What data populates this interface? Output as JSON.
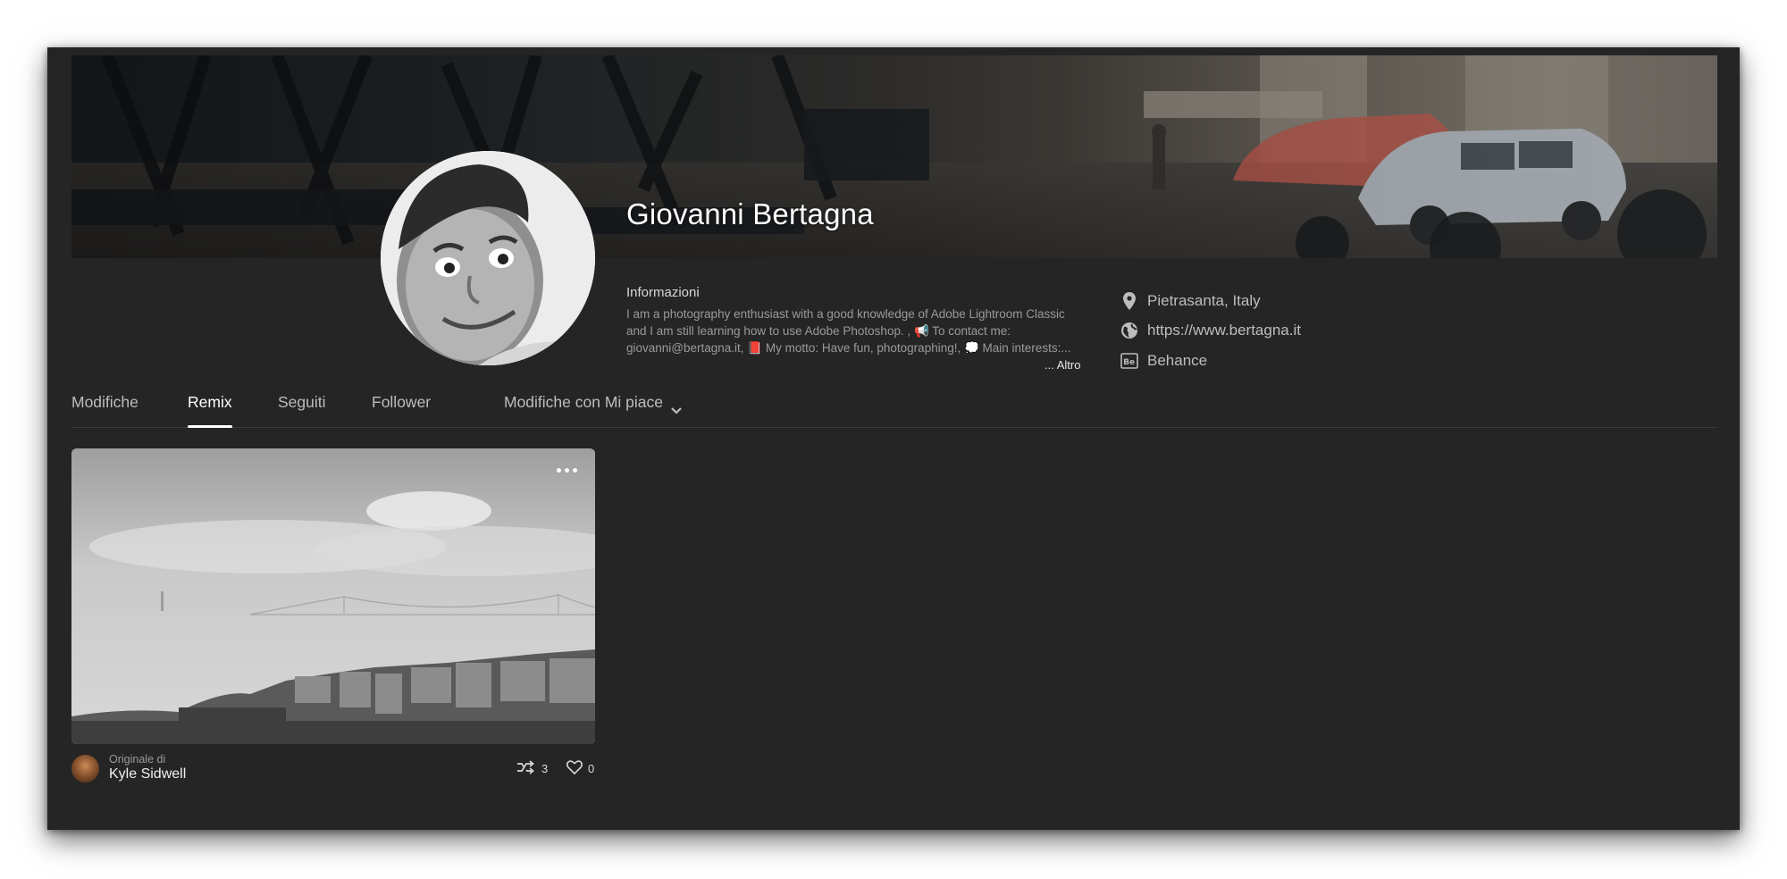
{
  "profile": {
    "name": "Giovanni Bertagna",
    "about_title": "Informazioni",
    "about_text": "I am a photography enthusiast with a good knowledge of Adobe Lightroom Classic and I am still learning how to use Adobe Photoshop. , 📢 To contact me: giovanni@bertagna.it, 📕 My motto: Have fun, photographing!, 💭 Main interests:...",
    "more_label": "... Altro",
    "location": "Pietrasanta, Italy",
    "website": "https://www.bertagna.it",
    "behance": "Behance"
  },
  "icons": {
    "location": "location-pin-icon",
    "website": "globe-icon",
    "behance": "behance-icon",
    "remix": "remix-icon",
    "like": "heart-icon",
    "more": "more-options-icon",
    "dropdown": "chevron-down-icon"
  },
  "tabs": [
    {
      "label": "Modifiche",
      "active": false
    },
    {
      "label": "Remix",
      "active": true
    },
    {
      "label": "Seguiti",
      "active": false
    },
    {
      "label": "Follower",
      "active": false
    },
    {
      "label": "Modifiche con Mi piace",
      "active": false
    }
  ],
  "card": {
    "original_label": "Originale di",
    "author": "Kyle Sidwell",
    "remix_count": "3",
    "like_count": "0"
  },
  "colors": {
    "background": "#252525",
    "text_primary": "#ffffff",
    "text_secondary": "#9a9a9a"
  }
}
